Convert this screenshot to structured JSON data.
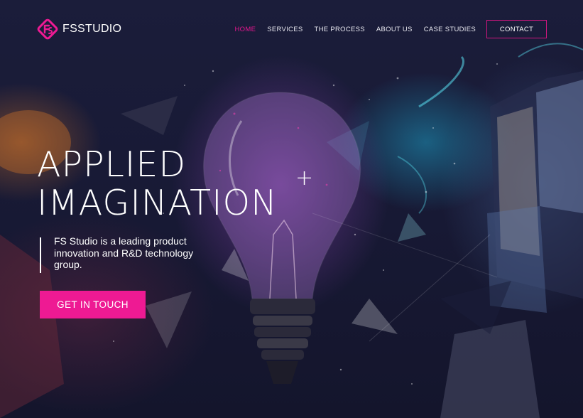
{
  "brand": {
    "name": "FSSTUDIO",
    "accent": "#ee1a93",
    "logo_icon": "fs-logo-mark"
  },
  "nav": {
    "items": [
      {
        "label": "HOME",
        "active": true
      },
      {
        "label": "SERVICES",
        "active": false
      },
      {
        "label": "THE PROCESS",
        "active": false
      },
      {
        "label": "ABOUT US",
        "active": false
      },
      {
        "label": "CASE STUDIES",
        "active": false
      }
    ],
    "contact_label": "CONTACT"
  },
  "hero": {
    "headline_line1": "APPLIED",
    "headline_line2": "IMAGINATION",
    "headline_mark": "+",
    "tagline": "FS Studio is a leading product innovation and R&D technology group.",
    "cta_label": "GET IN TOUCH",
    "background_image": "exploding lightbulb collage"
  }
}
